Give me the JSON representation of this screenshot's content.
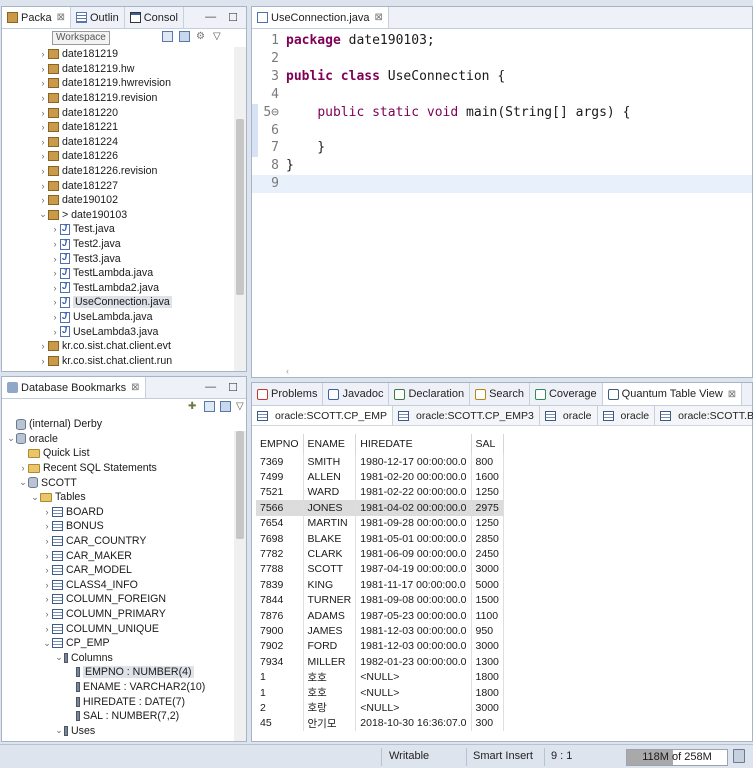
{
  "left_top_panel": {
    "tabs": [
      {
        "label": "Packa",
        "icon": "package-explorer-icon",
        "active": true
      },
      {
        "label": "Outlin",
        "icon": "outline-icon",
        "active": false
      },
      {
        "label": "Consol",
        "icon": "console-icon",
        "active": false
      }
    ],
    "tooltip": "Workspace",
    "tree": [
      {
        "label": "date181219",
        "type": "package",
        "indent": 1,
        "arrow": ">"
      },
      {
        "label": "date181219.hw",
        "type": "package",
        "indent": 1,
        "arrow": ">"
      },
      {
        "label": "date181219.hwrevision",
        "type": "package",
        "indent": 1,
        "arrow": ">"
      },
      {
        "label": "date181219.revision",
        "type": "package",
        "indent": 1,
        "arrow": ">"
      },
      {
        "label": "date181220",
        "type": "package",
        "indent": 1,
        "arrow": ">"
      },
      {
        "label": "date181221",
        "type": "package",
        "indent": 1,
        "arrow": ">"
      },
      {
        "label": "date181224",
        "type": "package",
        "indent": 1,
        "arrow": ">"
      },
      {
        "label": "date181226",
        "type": "package",
        "indent": 1,
        "arrow": ">"
      },
      {
        "label": "date181226.revision",
        "type": "package",
        "indent": 1,
        "arrow": ">"
      },
      {
        "label": "date181227",
        "type": "package",
        "indent": 1,
        "arrow": ">"
      },
      {
        "label": "date190102",
        "type": "package",
        "indent": 1,
        "arrow": ">"
      },
      {
        "label": "> date190103",
        "type": "package",
        "indent": 1,
        "arrow": "v"
      },
      {
        "label": "Test.java",
        "type": "java",
        "indent": 2,
        "arrow": ">"
      },
      {
        "label": "Test2.java",
        "type": "java",
        "indent": 2,
        "arrow": ">"
      },
      {
        "label": "Test3.java",
        "type": "java",
        "indent": 2,
        "arrow": ">"
      },
      {
        "label": "TestLambda.java",
        "type": "java",
        "indent": 2,
        "arrow": ">"
      },
      {
        "label": "TestLambda2.java",
        "type": "java",
        "indent": 2,
        "arrow": ">"
      },
      {
        "label": "UseConnection.java",
        "type": "java",
        "indent": 2,
        "arrow": ">",
        "selected": true
      },
      {
        "label": "UseLambda.java",
        "type": "java",
        "indent": 2,
        "arrow": ">"
      },
      {
        "label": "UseLambda3.java",
        "type": "java",
        "indent": 2,
        "arrow": ">"
      },
      {
        "label": "kr.co.sist.chat.client.evt",
        "type": "package",
        "indent": 1,
        "arrow": ">"
      },
      {
        "label": "kr.co.sist.chat.client.run",
        "type": "package",
        "indent": 1,
        "arrow": ">"
      }
    ]
  },
  "left_bottom_panel": {
    "tab": "Database Bookmarks",
    "tree": [
      {
        "label": "(internal) Derby",
        "type": "db",
        "indent": 0,
        "arrow": ""
      },
      {
        "label": "oracle",
        "type": "db",
        "indent": 0,
        "arrow": "v"
      },
      {
        "label": "Quick List",
        "type": "folder",
        "indent": 1,
        "arrow": ""
      },
      {
        "label": "Recent SQL Statements",
        "type": "folder",
        "indent": 1,
        "arrow": ">"
      },
      {
        "label": "SCOTT",
        "type": "schema",
        "indent": 1,
        "arrow": "v"
      },
      {
        "label": "Tables",
        "type": "folder",
        "indent": 2,
        "arrow": "v"
      },
      {
        "label": "BOARD",
        "type": "table",
        "indent": 3,
        "arrow": ">"
      },
      {
        "label": "BONUS",
        "type": "table",
        "indent": 3,
        "arrow": ">"
      },
      {
        "label": "CAR_COUNTRY",
        "type": "table",
        "indent": 3,
        "arrow": ">"
      },
      {
        "label": "CAR_MAKER",
        "type": "table",
        "indent": 3,
        "arrow": ">"
      },
      {
        "label": "CAR_MODEL",
        "type": "table",
        "indent": 3,
        "arrow": ">"
      },
      {
        "label": "CLASS4_INFO",
        "type": "table",
        "indent": 3,
        "arrow": ">"
      },
      {
        "label": "COLUMN_FOREIGN",
        "type": "table",
        "indent": 3,
        "arrow": ">"
      },
      {
        "label": "COLUMN_PRIMARY",
        "type": "table",
        "indent": 3,
        "arrow": ">"
      },
      {
        "label": "COLUMN_UNIQUE",
        "type": "table",
        "indent": 3,
        "arrow": ">"
      },
      {
        "label": "CP_EMP",
        "type": "table",
        "indent": 3,
        "arrow": "v"
      },
      {
        "label": "Columns",
        "type": "column",
        "indent": 4,
        "arrow": "v"
      },
      {
        "label": "EMPNO : NUMBER(4)",
        "type": "column",
        "indent": 5,
        "arrow": "",
        "selected": true
      },
      {
        "label": "ENAME : VARCHAR2(10)",
        "type": "column",
        "indent": 5,
        "arrow": ""
      },
      {
        "label": "HIREDATE : DATE(7)",
        "type": "column",
        "indent": 5,
        "arrow": ""
      },
      {
        "label": "SAL : NUMBER(7,2)",
        "type": "column",
        "indent": 5,
        "arrow": ""
      },
      {
        "label": "Uses",
        "type": "uses",
        "indent": 4,
        "arrow": "v"
      }
    ]
  },
  "editor": {
    "tab": "UseConnection.java",
    "lines": [
      {
        "n": "1",
        "code": [
          [
            "kw",
            "package"
          ],
          [
            "t",
            " date190103;"
          ]
        ]
      },
      {
        "n": "2",
        "code": []
      },
      {
        "n": "3",
        "code": [
          [
            "kw",
            "public"
          ],
          [
            "t",
            " "
          ],
          [
            "kw",
            "class"
          ],
          [
            "t",
            " UseConnection {"
          ]
        ]
      },
      {
        "n": "4",
        "code": []
      },
      {
        "n": "5⊖",
        "code": [
          [
            "t",
            "    "
          ],
          [
            "kw2",
            "public"
          ],
          [
            "t",
            " "
          ],
          [
            "kw2",
            "static"
          ],
          [
            "t",
            " "
          ],
          [
            "kw2",
            "void"
          ],
          [
            "t",
            " main(String[] args) {"
          ]
        ]
      },
      {
        "n": "6",
        "code": []
      },
      {
        "n": "7",
        "code": [
          [
            "t",
            "    }"
          ]
        ]
      },
      {
        "n": "8",
        "code": [
          [
            "t",
            "}"
          ]
        ]
      },
      {
        "n": "9",
        "code": []
      }
    ]
  },
  "bottom_panel": {
    "tabs": [
      {
        "label": "Problems",
        "icon": "problems-icon"
      },
      {
        "label": "Javadoc",
        "icon": "javadoc-icon"
      },
      {
        "label": "Declaration",
        "icon": "declaration-icon"
      },
      {
        "label": "Search",
        "icon": "search-icon"
      },
      {
        "label": "Coverage",
        "icon": "coverage-icon"
      },
      {
        "label": "Quantum Table View",
        "icon": "table-view-icon",
        "active": true
      }
    ],
    "subtabs": [
      "oracle:SCOTT.CP_EMP",
      "oracle:SCOTT.CP_EMP3",
      "oracle",
      "oracle",
      "oracle:SCOTT.BOARD"
    ],
    "table": {
      "headers": [
        "EMPNO",
        "ENAME",
        "HIREDATE",
        "SAL"
      ],
      "rows": [
        [
          "7369",
          "SMITH",
          "1980-12-17 00:00:00.0",
          "800"
        ],
        [
          "7499",
          "ALLEN",
          "1981-02-20 00:00:00.0",
          "1600"
        ],
        [
          "7521",
          "WARD",
          "1981-02-22 00:00:00.0",
          "1250"
        ],
        [
          "7566",
          "JONES",
          "1981-04-02 00:00:00.0",
          "2975"
        ],
        [
          "7654",
          "MARTIN",
          "1981-09-28 00:00:00.0",
          "1250"
        ],
        [
          "7698",
          "BLAKE",
          "1981-05-01 00:00:00.0",
          "2850"
        ],
        [
          "7782",
          "CLARK",
          "1981-06-09 00:00:00.0",
          "2450"
        ],
        [
          "7788",
          "SCOTT",
          "1987-04-19 00:00:00.0",
          "3000"
        ],
        [
          "7839",
          "KING",
          "1981-11-17 00:00:00.0",
          "5000"
        ],
        [
          "7844",
          "TURNER",
          "1981-09-08 00:00:00.0",
          "1500"
        ],
        [
          "7876",
          "ADAMS",
          "1987-05-23 00:00:00.0",
          "1100"
        ],
        [
          "7900",
          "JAMES",
          "1981-12-03 00:00:00.0",
          "950"
        ],
        [
          "7902",
          "FORD",
          "1981-12-03 00:00:00.0",
          "3000"
        ],
        [
          "7934",
          "MILLER",
          "1982-01-23 00:00:00.0",
          "1300"
        ],
        [
          "1",
          "호호",
          "<NULL>",
          "1800"
        ],
        [
          "1",
          "호호",
          "<NULL>",
          "1800"
        ],
        [
          "2",
          "호랑",
          "<NULL>",
          "3000"
        ],
        [
          "45",
          "안기모",
          "2018-10-30 16:36:07.0",
          "300"
        ]
      ],
      "selected_row": 3
    }
  },
  "status": {
    "mode": "Writable",
    "insert": "Smart Insert",
    "position": "9 : 1",
    "heap_used": "118M",
    "heap_sep": "of",
    "heap_total": "258M",
    "heap_used_fraction": 0.46
  }
}
